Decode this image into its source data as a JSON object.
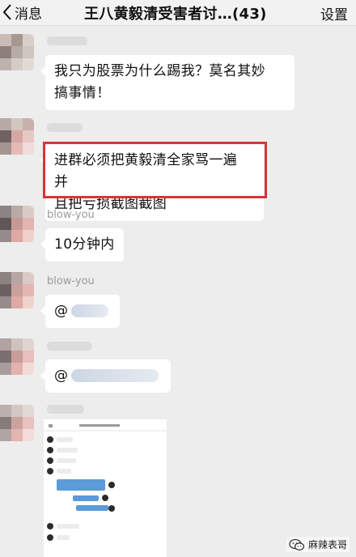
{
  "header": {
    "back_label": "消息",
    "title": "王八黄毅清受害者讨…(43)",
    "settings_label": "设置"
  },
  "messages": [
    {
      "sender": "",
      "text_lines": [
        "我只为股票为什么踢我？莫名其妙",
        "搞事情！"
      ]
    },
    {
      "sender": "",
      "text_lines": [
        "进群必须把黄毅清全家骂一遍 并",
        "且把亏损截图截图"
      ],
      "highlighted": true
    },
    {
      "sender": "blow-you",
      "text": "10分钟内"
    },
    {
      "sender": "blow-you",
      "text": "@"
    },
    {
      "sender": "",
      "text": "@"
    },
    {
      "sender": "",
      "type": "image"
    }
  ],
  "watermark": {
    "text": "麻辣表哥"
  },
  "colors": {
    "highlight": "#d9333b",
    "chat_background": "#ededed",
    "bubble": "#ffffff"
  }
}
